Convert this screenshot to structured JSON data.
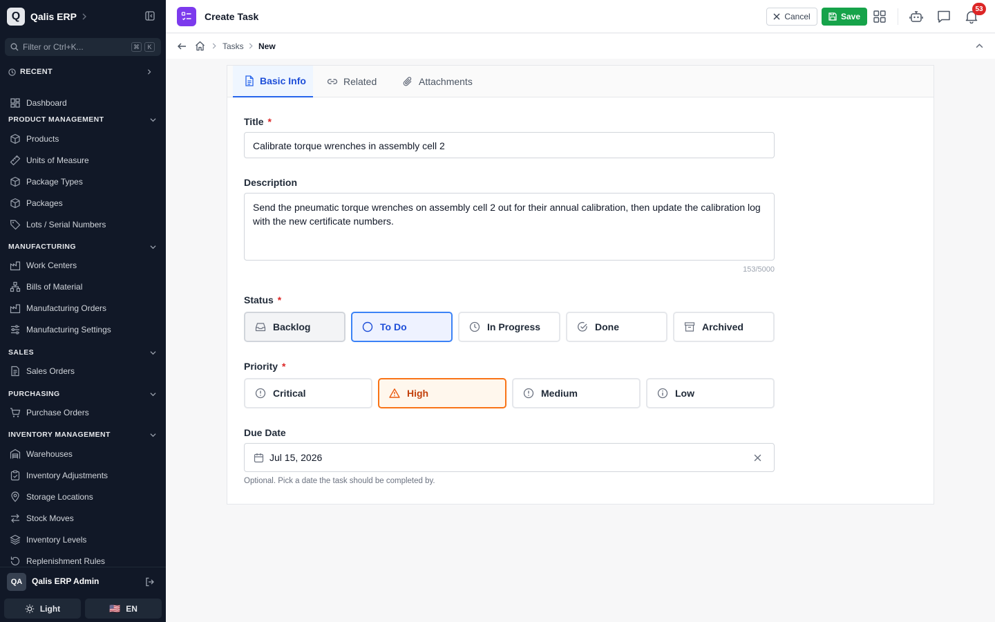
{
  "app": {
    "logo_letter": "Q",
    "name": "Qalis ERP"
  },
  "filter": {
    "placeholder": "Filter or Ctrl+K...",
    "kbd1": "⌘",
    "kbd2": "K"
  },
  "sidebar": {
    "recent_label": "RECENT",
    "dashboard": "Dashboard",
    "sections": {
      "product": "PRODUCT MANAGEMENT",
      "manufacturing": "MANUFACTURING",
      "sales": "SALES",
      "purchasing": "PURCHASING",
      "inventory": "INVENTORY MANAGEMENT"
    },
    "items": {
      "products": "Products",
      "uom": "Units of Measure",
      "package_types": "Package Types",
      "packages": "Packages",
      "lots": "Lots / Serial Numbers",
      "work_centers": "Work Centers",
      "boms": "Bills of Material",
      "mos": "Manufacturing Orders",
      "mfg_settings": "Manufacturing Settings",
      "sales_orders": "Sales Orders",
      "purchase_orders": "Purchase Orders",
      "warehouses": "Warehouses",
      "inv_adjust": "Inventory Adjustments",
      "storage": "Storage Locations",
      "stock_moves": "Stock Moves",
      "inv_levels": "Inventory Levels",
      "replenish": "Replenishment Rules"
    },
    "user": {
      "initials": "QA",
      "name": "Qalis ERP Admin"
    },
    "theme_label": "Light",
    "lang_flag": "🇺🇸",
    "lang_label": "EN"
  },
  "topbar": {
    "title": "Create Task",
    "cancel_label": "Cancel",
    "save_label": "Save",
    "notification_count": "53"
  },
  "breadcrumb": {
    "tasks": "Tasks",
    "current": "New"
  },
  "tabs": {
    "basic": "Basic Info",
    "related": "Related",
    "attachments": "Attachments"
  },
  "form": {
    "title_label": "Title",
    "title_value": "Calibrate torque wrenches in assembly cell 2",
    "description_label": "Description",
    "description_value": "Send the pneumatic torque wrenches on assembly cell 2 out for their annual calibration, then update the calibration log with the new certificate numbers.",
    "description_counter": "153/5000",
    "status_label": "Status",
    "status_options": {
      "backlog": "Backlog",
      "todo": "To Do",
      "in_progress": "In Progress",
      "done": "Done",
      "archived": "Archived"
    },
    "status_selected": "To Do",
    "priority_label": "Priority",
    "priority_options": {
      "critical": "Critical",
      "high": "High",
      "medium": "Medium",
      "low": "Low"
    },
    "priority_selected": "High",
    "due_label": "Due Date",
    "due_value": "Jul 15, 2026",
    "due_hint": "Optional. Pick a date the task should be completed by.",
    "required_mark": "*"
  },
  "colors": {
    "sidebar_bg": "#111827",
    "save_green": "#16a34a",
    "accent_blue": "#2563eb",
    "high_orange": "#f97316",
    "page_icon_purple": "#7c3aed",
    "badge_red": "#dc2626"
  }
}
